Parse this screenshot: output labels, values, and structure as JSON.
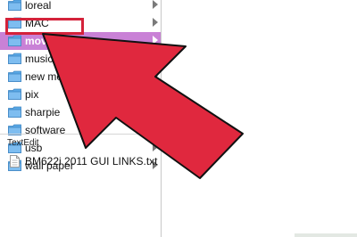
{
  "colors": {
    "selection": "#c981d6",
    "highlight_border": "#d4223a",
    "arrow_fill": "#e0283e",
    "arrow_stroke": "#111111",
    "folder": "#5aa8e6"
  },
  "folders": [
    {
      "label": "loreal",
      "selected": false
    },
    {
      "label": "MAC",
      "selected": false
    },
    {
      "label": "movies",
      "selected": true
    },
    {
      "label": "music",
      "selected": false
    },
    {
      "label": "new mo",
      "selected": false
    },
    {
      "label": "pix",
      "selected": false
    },
    {
      "label": "sharpie",
      "selected": false
    },
    {
      "label": "software",
      "selected": false
    },
    {
      "label": "usb",
      "selected": false
    },
    {
      "label": "wall paper",
      "selected": false
    }
  ],
  "section": {
    "header": "TextEdit"
  },
  "file": {
    "label": "BM622i 2011 GUI LINKS.txt",
    "icon": "text-file-icon"
  },
  "overlay": {
    "arrow_icon": "pointer-arrow-icon"
  }
}
